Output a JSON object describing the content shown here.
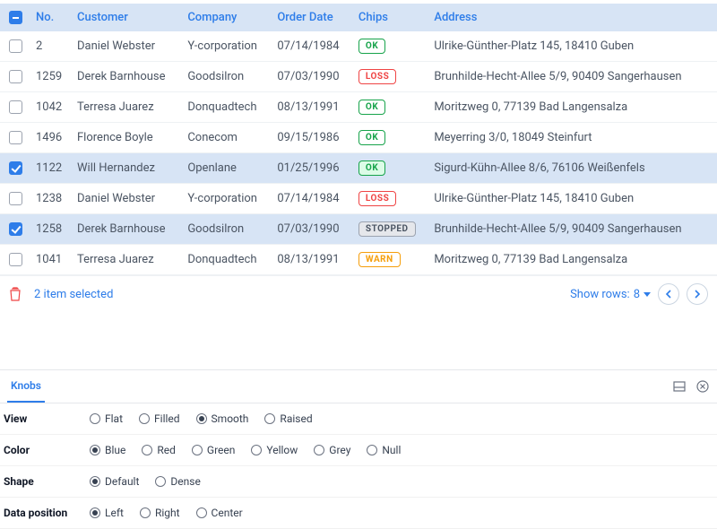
{
  "columns": [
    "No.",
    "Customer",
    "Company",
    "Order Date",
    "Chips",
    "Address"
  ],
  "rows": [
    {
      "no": "2",
      "customer": "Daniel Webster",
      "company": "Y-corporation",
      "date": "07/14/1984",
      "chip": "OK",
      "chipClass": "ok",
      "address": "Ulrike-Günther-Platz 145, 18410 Guben",
      "selected": false
    },
    {
      "no": "1259",
      "customer": "Derek Barnhouse",
      "company": "Goodsilron",
      "date": "07/03/1990",
      "chip": "LOSS",
      "chipClass": "loss",
      "address": "Brunhilde-Hecht-Allee 5/9, 90409 Sangerhausen",
      "selected": false
    },
    {
      "no": "1042",
      "customer": "Terresa Juarez",
      "company": "Donquadtech",
      "date": "08/13/1991",
      "chip": "OK",
      "chipClass": "ok",
      "address": "Moritzweg 0, 77139 Bad Langensalza",
      "selected": false
    },
    {
      "no": "1496",
      "customer": "Florence Boyle",
      "company": "Conecom",
      "date": "09/15/1986",
      "chip": "OK",
      "chipClass": "ok",
      "address": "Meyerring 3/0, 18049 Steinfurt",
      "selected": false
    },
    {
      "no": "1122",
      "customer": "Will Hernandez",
      "company": "Openlane",
      "date": "01/25/1996",
      "chip": "OK",
      "chipClass": "ok sel",
      "address": "Sigurd-Kühn-Allee 8/6, 76106 Weißenfels",
      "selected": true
    },
    {
      "no": "1238",
      "customer": "Daniel Webster",
      "company": "Y-corporation",
      "date": "07/14/1984",
      "chip": "LOSS",
      "chipClass": "loss",
      "address": "Ulrike-Günther-Platz 145, 18410 Guben",
      "selected": false
    },
    {
      "no": "1258",
      "customer": "Derek Barnhouse",
      "company": "Goodsilron",
      "date": "07/03/1990",
      "chip": "STOPPED",
      "chipClass": "stopped",
      "address": "Brunhilde-Hecht-Allee 5/9, 90409 Sangerhausen",
      "selected": true
    },
    {
      "no": "1041",
      "customer": "Terresa Juarez",
      "company": "Donquadtech",
      "date": "08/13/1991",
      "chip": "WARN",
      "chipClass": "warn",
      "address": "Moritzweg 0, 77139 Bad Langensalza",
      "selected": false
    }
  ],
  "footer": {
    "selected_text": "2 item selected",
    "show_rows_label": "Show rows:",
    "show_rows_value": "8"
  },
  "knobs": {
    "tab": "Knobs",
    "groups": [
      {
        "label": "View",
        "options": [
          "Flat",
          "Filled",
          "Smooth",
          "Raised"
        ],
        "selected": "Smooth"
      },
      {
        "label": "Color",
        "options": [
          "Blue",
          "Red",
          "Green",
          "Yellow",
          "Grey",
          "Null"
        ],
        "selected": "Blue"
      },
      {
        "label": "Shape",
        "options": [
          "Default",
          "Dense"
        ],
        "selected": "Default"
      },
      {
        "label": "Data position",
        "options": [
          "Left",
          "Right",
          "Center"
        ],
        "selected": "Left"
      }
    ]
  }
}
